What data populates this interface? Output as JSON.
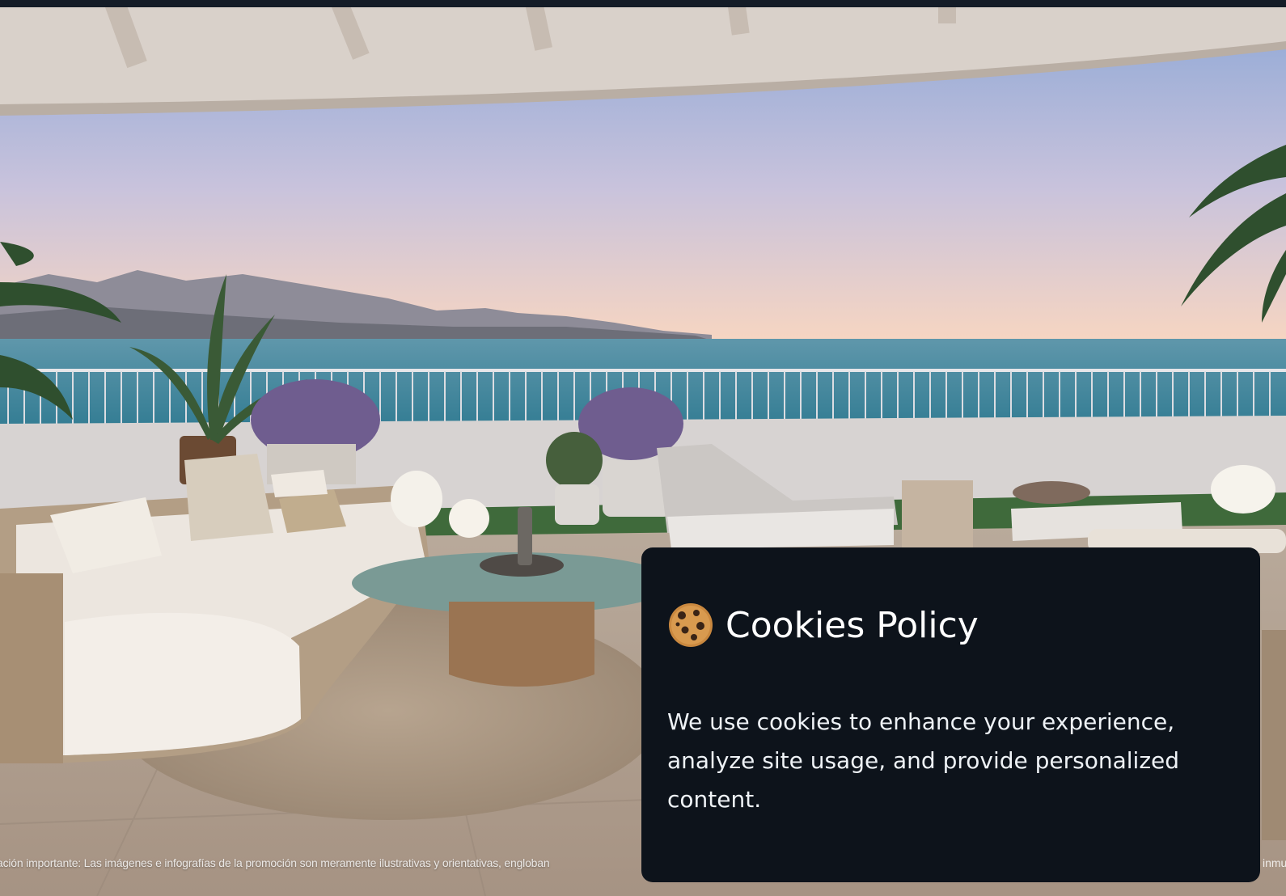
{
  "colors": {
    "top_bar": "#141c27",
    "card_background": "#0d131b",
    "card_text": "#ffffff",
    "sky_top": "#8fa8d6",
    "sky_horizon": "#f6d5c2",
    "sea": "#2f7a91"
  },
  "hero": {
    "description_icon": "terrace-sea-view-photo",
    "disclaimer": "ación importante: Las imágenes e infografías de la promoción son meramente ilustrativas y orientativas, engloban",
    "disclaimer_right": "inmu"
  },
  "cookie_banner": {
    "icon": "cookie-icon",
    "title": "Cookies Policy",
    "body": "We use cookies to enhance your experience, analyze site usage, and provide personalized content."
  }
}
